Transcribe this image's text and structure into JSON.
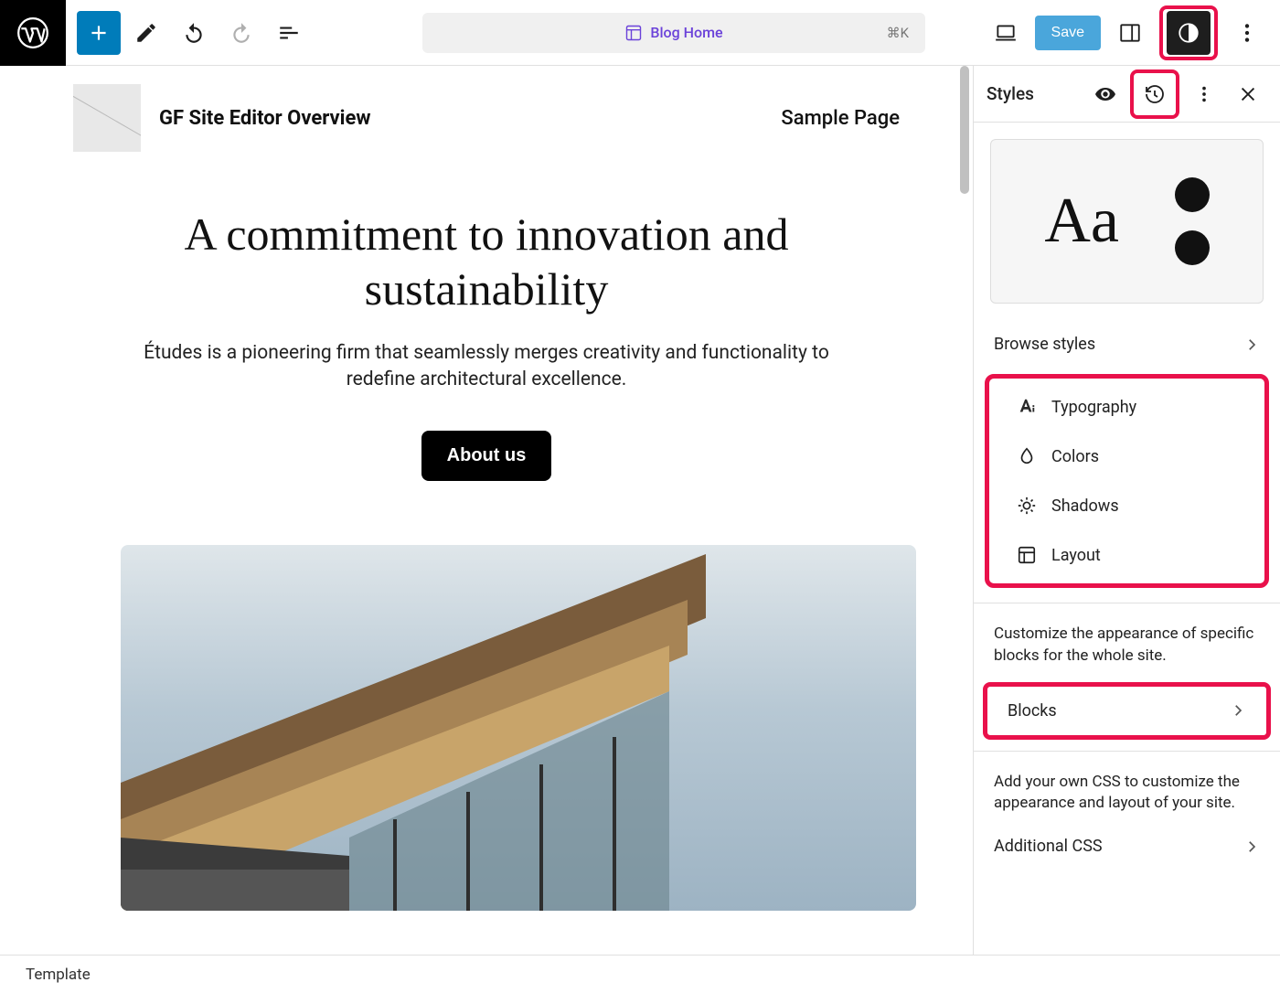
{
  "topbar": {
    "breadcrumb_label": "Blog Home",
    "shortcut": "⌘K",
    "save_label": "Save"
  },
  "canvas": {
    "site_title": "GF Site Editor Overview",
    "nav_item": "Sample Page",
    "hero_heading": "A commitment to innovation and sustainability",
    "hero_sub": "Études is a pioneering firm that seamlessly merges creativity and functionality to redefine architectural excellence.",
    "cta_label": "About us"
  },
  "sidebar": {
    "title": "Styles",
    "preview_text": "Aa",
    "browse_label": "Browse styles",
    "groups": [
      {
        "icon": "typography-icon",
        "label": "Typography"
      },
      {
        "icon": "drop-icon",
        "label": "Colors"
      },
      {
        "icon": "sun-icon",
        "label": "Shadows"
      },
      {
        "icon": "layout-icon",
        "label": "Layout"
      }
    ],
    "blocks_intro": "Customize the appearance of specific blocks for the whole site.",
    "blocks_label": "Blocks",
    "css_intro": "Add your own CSS to customize the appearance and layout of your site.",
    "css_label": "Additional CSS"
  },
  "footer": {
    "crumb": "Template"
  }
}
